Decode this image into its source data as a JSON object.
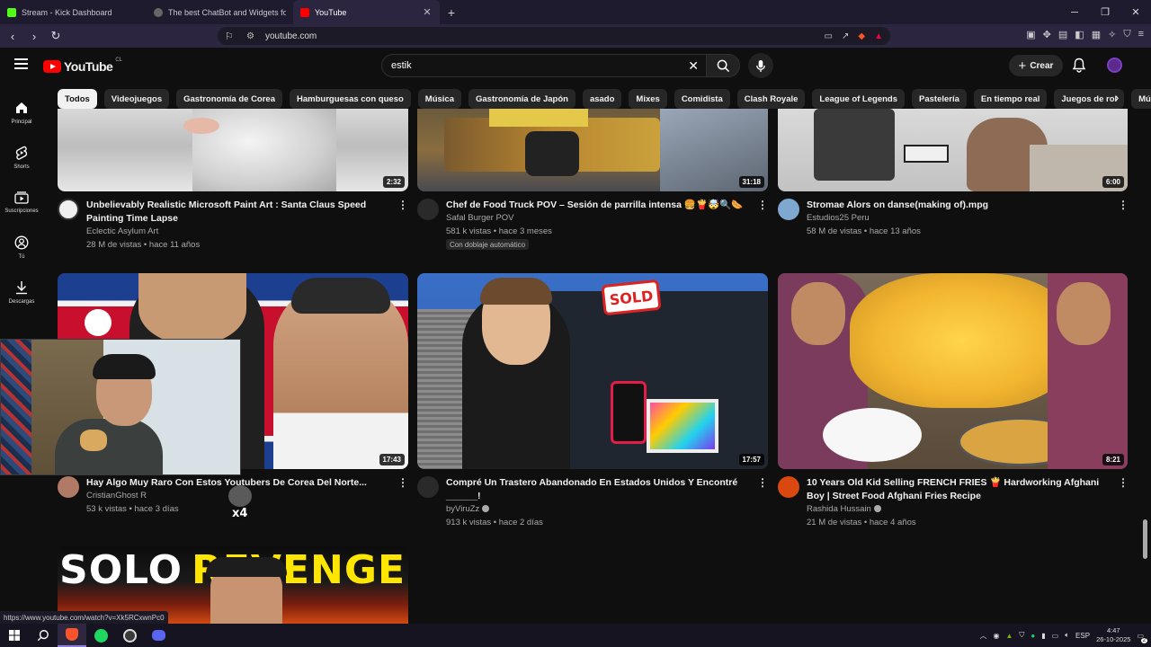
{
  "browser": {
    "tabs": [
      {
        "label": "Stream - Kick Dashboard",
        "color": "#53fc18",
        "active": false
      },
      {
        "label": "The best ChatBot and Widgets for Ki",
        "color": "#888888",
        "active": false
      },
      {
        "label": "YouTube",
        "color": "#ff0000",
        "active": true
      }
    ],
    "url": "youtube.com"
  },
  "youtube": {
    "logo_text": "YouTube",
    "country_code": "CL",
    "search_query": "estik",
    "create_label": "Crear",
    "sidebar": [
      {
        "label": "Principal",
        "icon": "home-icon"
      },
      {
        "label": "Shorts",
        "icon": "shorts-icon"
      },
      {
        "label": "Suscripciones",
        "icon": "subscriptions-icon"
      },
      {
        "label": "Tú",
        "icon": "user-icon"
      },
      {
        "label": "Descargas",
        "icon": "download-icon"
      }
    ],
    "chips": [
      "Todos",
      "Videojuegos",
      "Gastronomía de Corea",
      "Hamburguesas con queso",
      "Música",
      "Gastronomía de Japón",
      "asado",
      "Mixes",
      "Comidista",
      "Clash Royale",
      "League of Legends",
      "Pastelería",
      "En tiempo real",
      "Juegos de rol",
      "Músic"
    ],
    "videos": [
      {
        "title": "Unbelievably Realistic Microsoft Paint Art : Santa Claus Speed Painting Time Lapse",
        "channel": "Eclectic Asylum Art",
        "stats": "28 M de vistas • hace 11 años",
        "duration": "2:32",
        "verified": false
      },
      {
        "title": "Chef de Food Truck POV – Sesión de parrilla intensa 🍔🍟🤯🔍🌭",
        "channel": "Safal Burger POV",
        "stats": "581 k vistas • hace 3 meses",
        "duration": "31:18",
        "badge": "Con doblaje automático",
        "verified": false
      },
      {
        "title": "Stromae   Alors on danse(making of).mpg",
        "channel": "Estudios25 Peru",
        "stats": "58 M de vistas • hace 13 años",
        "duration": "6:00",
        "verified": false
      },
      {
        "title": "Hay Algo Muy Raro Con Estos Youtubers De Corea Del Norte...",
        "channel": "CristianGhost R",
        "stats": "53 k vistas • hace 3 días",
        "duration": "17:43",
        "verified": false
      },
      {
        "title": "Compré Un Trastero Abandonado En Estados Unidos Y Encontré ______!",
        "channel": "byViruZz",
        "stats": "913 k vistas • hace 2 días",
        "duration": "17:57",
        "verified": true
      },
      {
        "title": "10 Years Old Kid Selling FRENCH FRIES 🍟 Hardworking Afghani Boy | Street Food Afghani Fries Recipe",
        "channel": "Rashida Hussain",
        "stats": "21 M de vistas • hace 4 años",
        "duration": "8:21",
        "verified": true
      }
    ],
    "thumb_text": {
      "sold": "SOLD",
      "solo": "SOLO",
      "revenge": "REVENGE"
    },
    "overlay_text": "x4"
  },
  "status_url": "https://www.youtube.com/watch?v=Xk5RCxwnPc0",
  "taskbar": {
    "language": "ESP",
    "time": "4:47",
    "date": "26-10-2025",
    "notifications": "2"
  }
}
